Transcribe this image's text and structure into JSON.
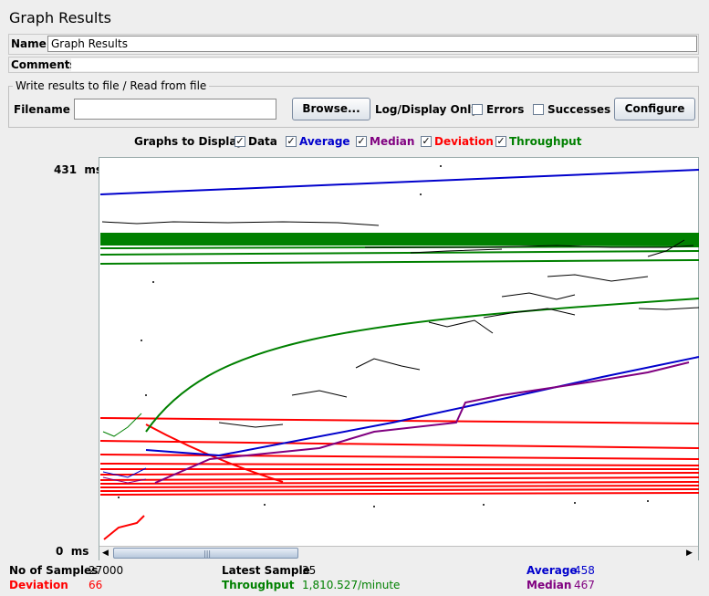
{
  "window": {
    "title": "Graph Results"
  },
  "name_field": {
    "label": "Name:",
    "value": "Graph Results"
  },
  "comments_field": {
    "label": "Comments:",
    "value": ""
  },
  "file_section": {
    "legend": "Write results to file / Read from file",
    "filename_label": "Filename",
    "filename_value": "",
    "browse_label": "Browse...",
    "log_display_label": "Log/Display Only:",
    "errors_label": "Errors",
    "successes_label": "Successes",
    "configure_label": "Configure"
  },
  "graphs_to_display": {
    "label": "Graphs to Display",
    "options": [
      {
        "label": "Data",
        "checked": true,
        "color": "#000000"
      },
      {
        "label": "Average",
        "checked": true,
        "color": "#0000cc"
      },
      {
        "label": "Median",
        "checked": true,
        "color": "#800080"
      },
      {
        "label": "Deviation",
        "checked": true,
        "color": "#ff0000"
      },
      {
        "label": "Throughput",
        "checked": true,
        "color": "#008000"
      }
    ]
  },
  "graph": {
    "y_max_label": "431",
    "y_min_label": "0",
    "unit": "ms"
  },
  "stats": {
    "samples_label": "No of Samples",
    "samples_value": "27000",
    "latest_label": "Latest Sample",
    "latest_value": "35",
    "average_label": "Average",
    "average_value": "458",
    "deviation_label": "Deviation",
    "deviation_value": "66",
    "throughput_label": "Throughput",
    "throughput_value": "1,810.527/minute",
    "median_label": "Median",
    "median_value": "467"
  },
  "colors": {
    "data": "#000000",
    "average": "#0000cc",
    "median": "#800080",
    "deviation": "#ff0000",
    "throughput": "#008000"
  }
}
